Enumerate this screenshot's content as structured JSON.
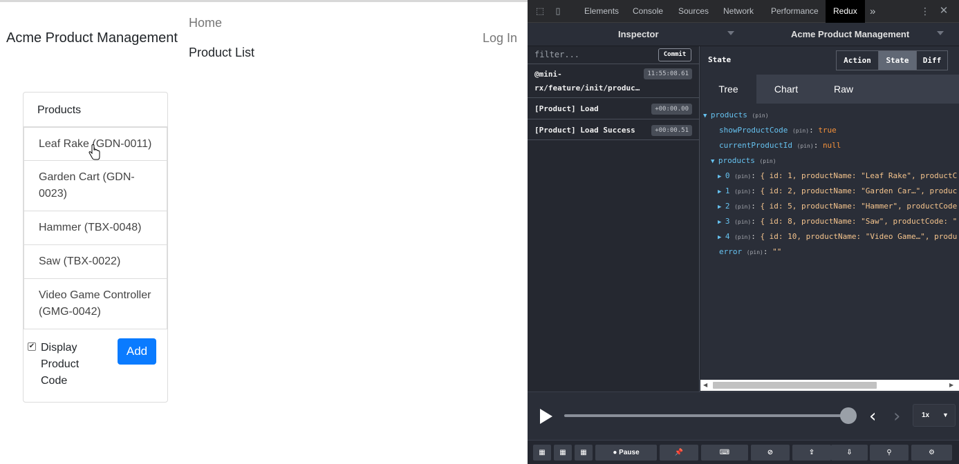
{
  "app": {
    "brand": "Acme Product Management",
    "nav_home": "Home",
    "nav_product_list": "Product List",
    "nav_login": "Log In",
    "card_header": "Products",
    "products": [
      "Leaf Rake (GDN-0011)",
      "Garden Cart (GDN-0023)",
      "Hammer (TBX-0048)",
      "Saw (TBX-0022)",
      "Video Game Controller (GMG-0042)"
    ],
    "checkbox_label": "Display Product Code",
    "checkbox_checked": true,
    "add_button": "Add"
  },
  "devtools": {
    "tabs": [
      "Elements",
      "Console",
      "Sources",
      "Network",
      "Performance",
      "Redux"
    ],
    "active_tab": "Redux",
    "more_tabs_icon": "»",
    "inspector_label": "Inspector",
    "store_label": "Acme Product Management",
    "filter_placeholder": "filter...",
    "commit_label": "Commit",
    "actions": [
      {
        "name_line1": "@mini-",
        "name_line2": "rx/feature/init/produc…",
        "time": "11:55:08.61"
      },
      {
        "name_line1": "[Product] Load",
        "name_line2": "",
        "time": "+00:00.00"
      },
      {
        "name_line1": "[Product] Load Success",
        "name_line2": "",
        "time": "+00:00.51"
      }
    ],
    "state_title": "State",
    "mode_buttons": [
      "Action",
      "State",
      "Diff"
    ],
    "selected_mode": "State",
    "subtabs": [
      "Tree",
      "Chart",
      "Raw"
    ],
    "selected_subtab": "Tree",
    "tree": {
      "root_key": "products",
      "pin": "(pin)",
      "show_product_code_key": "showProductCode",
      "show_product_code_val": "true",
      "current_product_id_key": "currentProductId",
      "current_product_id_val": "null",
      "products_key": "products",
      "items": [
        {
          "index": "0",
          "preview": "{ id: 1, productName: \"Leaf Rake\", productC"
        },
        {
          "index": "1",
          "preview": "{ id: 2, productName: \"Garden Car…\", produc"
        },
        {
          "index": "2",
          "preview": "{ id: 5, productName: \"Hammer\", productCode"
        },
        {
          "index": "3",
          "preview": "{ id: 8, productName: \"Saw\", productCode: \""
        },
        {
          "index": "4",
          "preview": "{ id: 10, productName: \"Video Game…\", produ"
        }
      ],
      "error_key": "error",
      "error_val": "\"\""
    },
    "speed": "1x",
    "pause_label": "Pause"
  }
}
